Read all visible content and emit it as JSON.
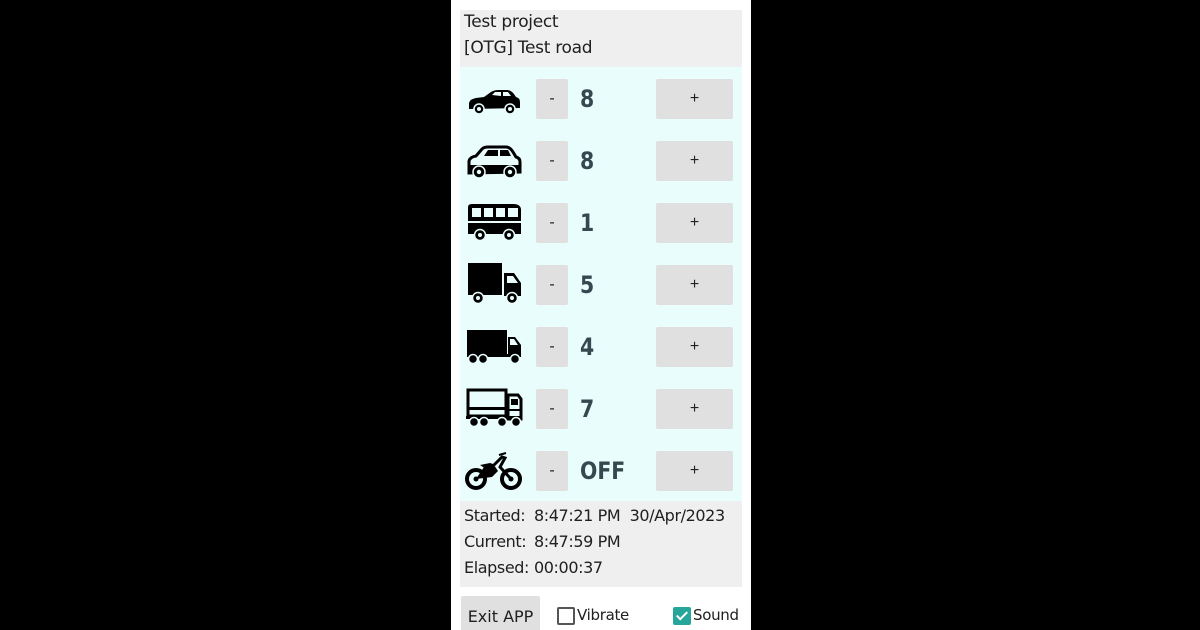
{
  "header": {
    "project": "Test project",
    "road": "[OTG] Test road"
  },
  "counters": [
    {
      "icon": "car-sedan-icon",
      "minus_label": "-",
      "count": "8",
      "plus_label": "+"
    },
    {
      "icon": "suv-icon",
      "minus_label": "-",
      "count": "8",
      "plus_label": "+"
    },
    {
      "icon": "bus-icon",
      "minus_label": "-",
      "count": "1",
      "plus_label": "+"
    },
    {
      "icon": "box-truck-icon",
      "minus_label": "-",
      "count": "5",
      "plus_label": "+"
    },
    {
      "icon": "medium-truck-icon",
      "minus_label": "-",
      "count": "4",
      "plus_label": "+"
    },
    {
      "icon": "semi-truck-icon",
      "minus_label": "-",
      "count": "7",
      "plus_label": "+"
    },
    {
      "icon": "motorcycle-icon",
      "minus_label": "-",
      "count": "OFF",
      "plus_label": "+"
    }
  ],
  "status": {
    "started_label": "Started:",
    "started_value": "8:47:21 PM  30/Apr/2023",
    "current_label": "Current:",
    "current_value": "8:47:59 PM",
    "elapsed_label": "Elapsed:",
    "elapsed_value": "00:00:37"
  },
  "footer": {
    "exit_label": "Exit APP",
    "vibrate_label": "Vibrate",
    "vibrate_checked": false,
    "sound_label": "Sound",
    "sound_checked": true
  },
  "colors": {
    "counter_bg": "#e9fdfd",
    "panel_bg": "#efefef",
    "button_bg": "#e0e0e0",
    "count_text": "#37474f",
    "checkbox_accent": "#26a69a"
  }
}
